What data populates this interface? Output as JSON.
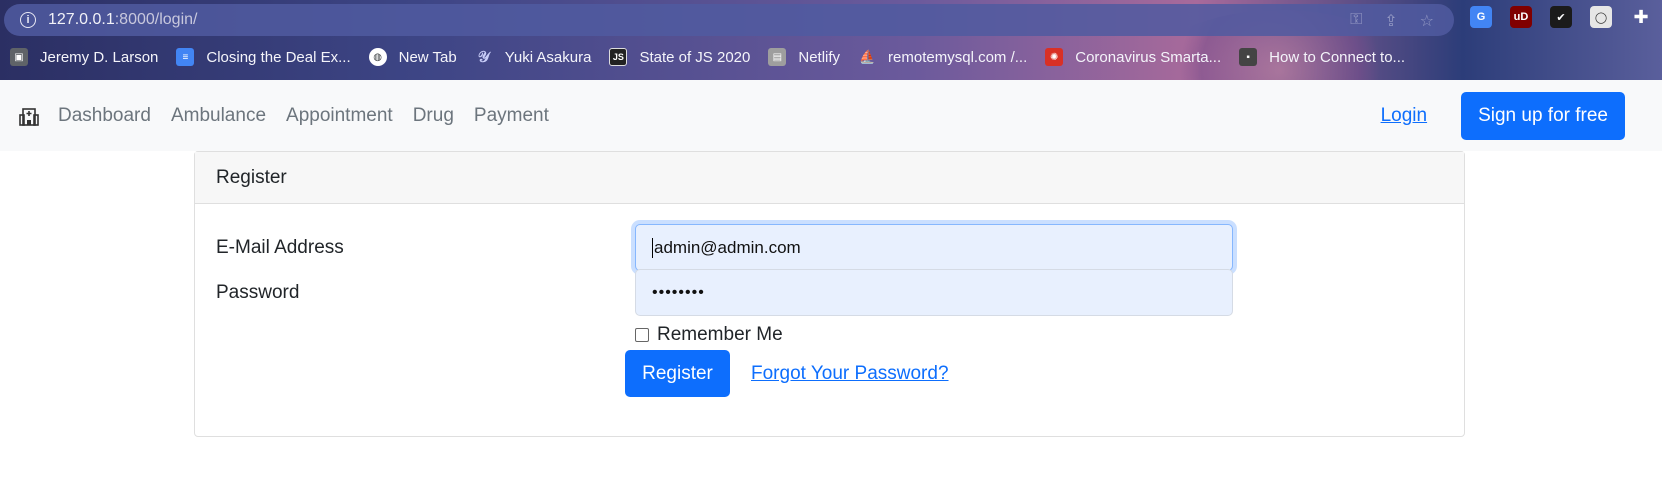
{
  "browser": {
    "url_host": "127.0.0.1",
    "url_rest": ":8000/login/",
    "bookmarks": [
      {
        "label": "Jeremy D. Larson",
        "icon": "cube-icon",
        "color": "#5f6368"
      },
      {
        "label": "Closing the Deal Ex...",
        "icon": "docs-icon",
        "color": "#4285f4"
      },
      {
        "label": "New Tab",
        "icon": "globe-icon",
        "color": "#e8eaed"
      },
      {
        "label": "Yuki Asakura",
        "icon": "signature-icon",
        "color": "#5b6fd6"
      },
      {
        "label": "State of JS 2020",
        "icon": "js-icon",
        "color": "#222222"
      },
      {
        "label": "Netlify",
        "icon": "netlify-icon",
        "color": "#9e9e9e"
      },
      {
        "label": "remotemysql.com /...",
        "icon": "phpmyadmin-icon",
        "color": "#f29111"
      },
      {
        "label": "Coronavirus Smarta...",
        "icon": "virus-icon",
        "color": "#d93025"
      },
      {
        "label": "How to Connect to...",
        "icon": "floppy-icon",
        "color": "#444444"
      }
    ]
  },
  "navbar": {
    "brand_icon": "hospital-icon",
    "links": [
      "Dashboard",
      "Ambulance",
      "Appointment",
      "Drug",
      "Payment"
    ],
    "login": "Login",
    "signup": "Sign up for free"
  },
  "form": {
    "header": "Register",
    "email_label": "E-Mail Address",
    "email_value": "admin@admin.com",
    "password_label": "Password",
    "password_value": "••••••••",
    "remember_label": "Remember Me",
    "submit_label": "Register",
    "forgot_label": "Forgot Your Password?"
  },
  "colors": {
    "primary": "#0d6efd",
    "navbar_bg": "#f8f9fa",
    "autofill_bg": "#e8f0fe"
  }
}
